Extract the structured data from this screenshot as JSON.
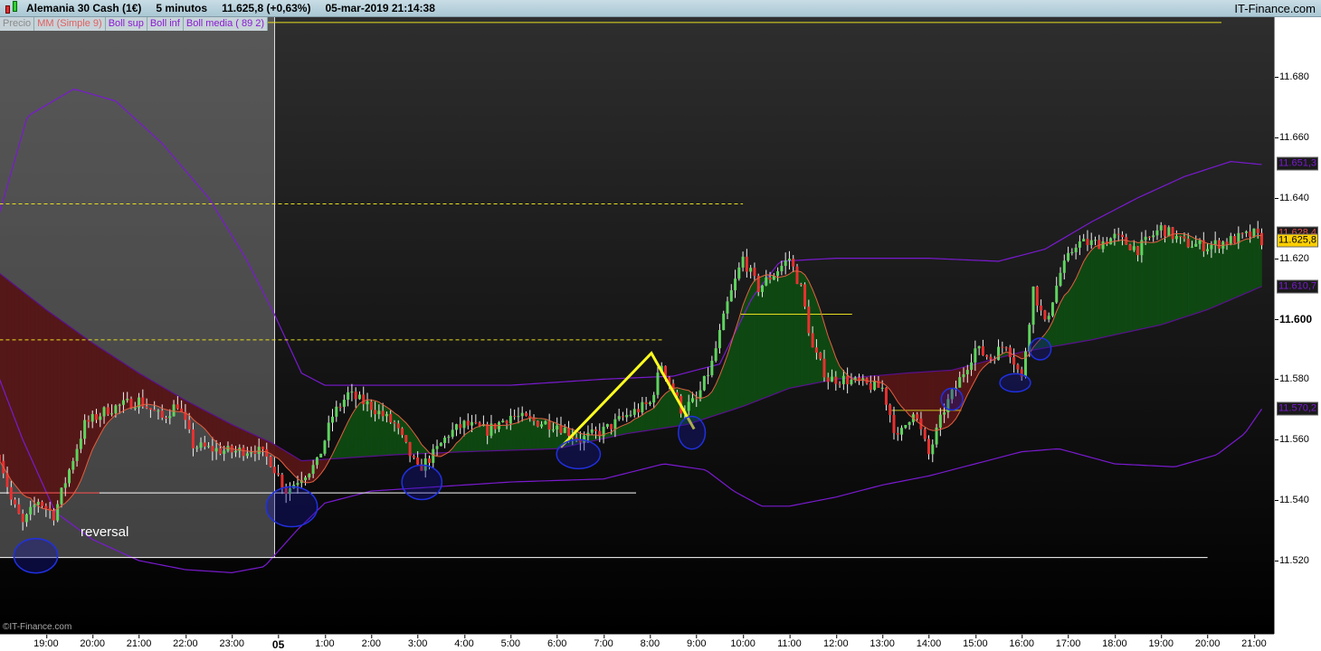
{
  "header": {
    "instrument": "Alemania 30 Cash (1€)",
    "timeframe": "5 minutos",
    "price": "11.625,8 (+0,63%)",
    "datetime": "05-mar-2019 21:14:38",
    "brand": "IT-Finance.com"
  },
  "legend": [
    {
      "label": "Precio",
      "color": "#8a8a8a"
    },
    {
      "label": "MM (Simple 9)",
      "color": "#e06060"
    },
    {
      "label": "Boll sup",
      "color": "#8a1ad0"
    },
    {
      "label": "Boll inf",
      "color": "#8a1ad0"
    },
    {
      "label": "Boll media ( 89 2)",
      "color": "#8a1ad0"
    }
  ],
  "copyright": "©IT-Finance.com",
  "annotation_text": "reversal",
  "chart_data": {
    "type": "candlestick",
    "timeframe_minutes": 5,
    "ylim": [
      11.5005,
      11.704
    ],
    "y_ticks": [
      {
        "v": 11.68,
        "label": "11.680"
      },
      {
        "v": 11.66,
        "label": "11.660"
      },
      {
        "v": 11.64,
        "label": "11.640"
      },
      {
        "v": 11.62,
        "label": "11.620"
      },
      {
        "v": 11.6,
        "label": "11.600",
        "bold": true
      },
      {
        "v": 11.58,
        "label": "11.580"
      },
      {
        "v": 11.56,
        "label": "11.560"
      },
      {
        "v": 11.54,
        "label": "11.540"
      },
      {
        "v": 11.52,
        "label": "11.520"
      }
    ],
    "price_badges": [
      {
        "v": 11.6513,
        "label": "11.651,3",
        "color": "#7a1ad0",
        "bg": "#1a1a1a"
      },
      {
        "v": 11.6284,
        "label": "11.628,4",
        "color": "#e05050",
        "bg": "#1a1a1a"
      },
      {
        "v": 11.6258,
        "label": "11.625,8",
        "color": "#000",
        "bg": "#ffd000"
      },
      {
        "v": 11.6107,
        "label": "11.610,7",
        "color": "#7a1ad0",
        "bg": "#1a1a1a"
      },
      {
        "v": 11.5702,
        "label": "11.570,2",
        "color": "#7a1ad0",
        "bg": "#1a1a1a"
      }
    ],
    "x_ticks": [
      {
        "h": 1,
        "label": "19:00"
      },
      {
        "h": 2,
        "label": "20:00"
      },
      {
        "h": 3,
        "label": "21:00"
      },
      {
        "h": 4,
        "label": "22:00"
      },
      {
        "h": 5,
        "label": "23:00"
      },
      {
        "h": 6,
        "label": "05",
        "bold": true
      },
      {
        "h": 7,
        "label": "1:00"
      },
      {
        "h": 8,
        "label": "2:00"
      },
      {
        "h": 9,
        "label": "3:00"
      },
      {
        "h": 10,
        "label": "4:00"
      },
      {
        "h": 11,
        "label": "5:00"
      },
      {
        "h": 12,
        "label": "6:00"
      },
      {
        "h": 13,
        "label": "7:00"
      },
      {
        "h": 14,
        "label": "8:00"
      },
      {
        "h": 15,
        "label": "9:00"
      },
      {
        "h": 16,
        "label": "10:00"
      },
      {
        "h": 17,
        "label": "11:00"
      },
      {
        "h": 18,
        "label": "12:00"
      },
      {
        "h": 19,
        "label": "13:00"
      },
      {
        "h": 20,
        "label": "14:00"
      },
      {
        "h": 21,
        "label": "15:00"
      },
      {
        "h": 22,
        "label": "16:00"
      },
      {
        "h": 23,
        "label": "17:00"
      },
      {
        "h": 24,
        "label": "18:00"
      },
      {
        "h": 25,
        "label": "19:00"
      },
      {
        "h": 26,
        "label": "20:00"
      },
      {
        "h": 27,
        "label": "21:00"
      }
    ],
    "close_keypoints": [
      [
        0,
        11.555
      ],
      [
        0.25,
        11.54
      ],
      [
        0.5,
        11.532
      ],
      [
        0.83,
        11.54
      ],
      [
        1.17,
        11.535
      ],
      [
        1.5,
        11.55
      ],
      [
        1.83,
        11.565
      ],
      [
        2.33,
        11.57
      ],
      [
        3,
        11.573
      ],
      [
        3.5,
        11.567
      ],
      [
        3.83,
        11.572
      ],
      [
        4.17,
        11.558
      ],
      [
        4.5,
        11.557
      ],
      [
        5,
        11.556
      ],
      [
        5.5,
        11.557
      ],
      [
        5.83,
        11.553
      ],
      [
        6.17,
        11.543
      ],
      [
        6.5,
        11.548
      ],
      [
        6.83,
        11.552
      ],
      [
        7.17,
        11.568
      ],
      [
        7.5,
        11.575
      ],
      [
        8,
        11.571
      ],
      [
        8.5,
        11.565
      ],
      [
        9,
        11.55
      ],
      [
        9.33,
        11.555
      ],
      [
        9.67,
        11.562
      ],
      [
        10,
        11.565
      ],
      [
        10.5,
        11.563
      ],
      [
        11,
        11.568
      ],
      [
        11.5,
        11.566
      ],
      [
        12,
        11.565
      ],
      [
        12.5,
        11.56
      ],
      [
        13,
        11.563
      ],
      [
        13.5,
        11.568
      ],
      [
        14,
        11.572
      ],
      [
        14.25,
        11.585
      ],
      [
        14.67,
        11.57
      ],
      [
        15,
        11.573
      ],
      [
        15.33,
        11.585
      ],
      [
        15.67,
        11.605
      ],
      [
        16,
        11.62
      ],
      [
        16.33,
        11.61
      ],
      [
        16.67,
        11.615
      ],
      [
        17,
        11.62
      ],
      [
        17.25,
        11.61
      ],
      [
        17.5,
        11.59
      ],
      [
        17.83,
        11.58
      ],
      [
        18.17,
        11.58
      ],
      [
        18.67,
        11.578
      ],
      [
        19,
        11.577
      ],
      [
        19.33,
        11.56
      ],
      [
        19.67,
        11.57
      ],
      [
        20,
        11.555
      ],
      [
        20.33,
        11.57
      ],
      [
        20.67,
        11.58
      ],
      [
        21,
        11.59
      ],
      [
        21.33,
        11.587
      ],
      [
        21.67,
        11.592
      ],
      [
        22,
        11.58
      ],
      [
        22.25,
        11.61
      ],
      [
        22.5,
        11.598
      ],
      [
        22.83,
        11.615
      ],
      [
        23.17,
        11.625
      ],
      [
        23.67,
        11.625
      ],
      [
        24,
        11.627
      ],
      [
        24.5,
        11.623
      ],
      [
        25,
        11.63
      ],
      [
        25.5,
        11.625
      ],
      [
        26,
        11.624
      ],
      [
        26.5,
        11.626
      ],
      [
        27,
        11.628
      ],
      [
        27.17,
        11.6258
      ]
    ],
    "series": [
      {
        "name": "Boll sup",
        "color": "#7a1ad0",
        "points": [
          [
            0,
            11.635
          ],
          [
            0.6,
            11.667
          ],
          [
            1.6,
            11.676
          ],
          [
            2.5,
            11.672
          ],
          [
            3.5,
            11.658
          ],
          [
            4.5,
            11.64
          ],
          [
            5.3,
            11.62
          ],
          [
            5.9,
            11.602
          ],
          [
            6.5,
            11.582
          ],
          [
            7,
            11.578
          ],
          [
            9,
            11.578
          ],
          [
            11,
            11.578
          ],
          [
            13,
            11.58
          ],
          [
            14.5,
            11.581
          ],
          [
            15.5,
            11.585
          ],
          [
            16.2,
            11.607
          ],
          [
            16.8,
            11.619
          ],
          [
            18,
            11.62
          ],
          [
            20,
            11.62
          ],
          [
            21.5,
            11.619
          ],
          [
            22.5,
            11.623
          ],
          [
            23.5,
            11.632
          ],
          [
            24.5,
            11.64
          ],
          [
            25.5,
            11.647
          ],
          [
            26.5,
            11.652
          ],
          [
            27.17,
            11.651
          ]
        ]
      },
      {
        "name": "Boll inf",
        "color": "#7a1ad0",
        "points": [
          [
            0,
            11.58
          ],
          [
            0.5,
            11.56
          ],
          [
            1.2,
            11.536
          ],
          [
            2,
            11.527
          ],
          [
            3,
            11.52
          ],
          [
            4,
            11.517
          ],
          [
            5,
            11.516
          ],
          [
            5.7,
            11.518
          ],
          [
            6.4,
            11.53
          ],
          [
            7,
            11.539
          ],
          [
            8,
            11.543
          ],
          [
            9,
            11.544
          ],
          [
            11,
            11.546
          ],
          [
            13,
            11.547
          ],
          [
            14.3,
            11.552
          ],
          [
            15.2,
            11.55
          ],
          [
            15.8,
            11.543
          ],
          [
            16.4,
            11.538
          ],
          [
            17,
            11.538
          ],
          [
            18,
            11.541
          ],
          [
            19,
            11.545
          ],
          [
            20,
            11.548
          ],
          [
            21,
            11.552
          ],
          [
            22,
            11.556
          ],
          [
            22.8,
            11.557
          ],
          [
            24,
            11.552
          ],
          [
            25.3,
            11.551
          ],
          [
            26.2,
            11.555
          ],
          [
            26.8,
            11.562
          ],
          [
            27.17,
            11.5702
          ]
        ]
      },
      {
        "name": "Boll media",
        "color": "#5a1090",
        "points": [
          [
            0,
            11.615
          ],
          [
            1,
            11.603
          ],
          [
            2,
            11.592
          ],
          [
            3,
            11.582
          ],
          [
            4,
            11.573
          ],
          [
            5,
            11.565
          ],
          [
            5.85,
            11.559
          ],
          [
            6.5,
            11.553
          ],
          [
            7.5,
            11.554
          ],
          [
            8.5,
            11.555
          ],
          [
            10,
            11.556
          ],
          [
            12,
            11.557
          ],
          [
            13.5,
            11.562
          ],
          [
            14.8,
            11.565
          ],
          [
            16,
            11.571
          ],
          [
            17,
            11.577
          ],
          [
            18,
            11.58
          ],
          [
            19.5,
            11.582
          ],
          [
            20.5,
            11.583
          ],
          [
            22,
            11.589
          ],
          [
            23.5,
            11.593
          ],
          [
            25,
            11.598
          ],
          [
            26,
            11.603
          ],
          [
            27.17,
            11.6107
          ]
        ]
      }
    ],
    "moving_average": {
      "name": "MM (Simple 9)",
      "period": 9,
      "color": "#e06040"
    },
    "hlines": [
      {
        "v": 11.638,
        "h0": 0,
        "h1": 16,
        "color": "#e8e020",
        "dash": true
      },
      {
        "v": 11.593,
        "h0": 0,
        "h1": 14.3,
        "color": "#e8e020",
        "dash": true
      },
      {
        "v": 11.5424,
        "h0": 0,
        "h1": 13.7,
        "color": "#ffffff"
      },
      {
        "v": 11.521,
        "h0": 0,
        "h1": 26,
        "color": "#ffffff"
      },
      {
        "v": 11.698,
        "h0": 5.35,
        "h1": 26.3,
        "color": "#e8e020"
      },
      {
        "v": 11.5424,
        "h0": 0.2,
        "h1": 2.15,
        "color": "#e03030"
      },
      {
        "v": 11.6015,
        "h0": 15.95,
        "h1": 18.35,
        "color": "#e8e020"
      },
      {
        "v": 11.5697,
        "h0": 19.2,
        "h1": 20.7,
        "color": "#c8c020"
      }
    ],
    "zigzag": [
      [
        12.08,
        11.5575
      ],
      [
        14.03,
        11.5886
      ],
      [
        14.95,
        11.5635
      ]
    ],
    "ellipses": [
      [
        0.78,
        11.5216,
        0.47,
        0.0057
      ],
      [
        6.29,
        11.5378,
        0.55,
        0.0066
      ],
      [
        9.09,
        11.5459,
        0.43,
        0.0057
      ],
      [
        12.46,
        11.5552,
        0.47,
        0.0048
      ],
      [
        14.9,
        11.5623,
        0.29,
        0.0054
      ],
      [
        20.5,
        11.5734,
        0.23,
        0.0036
      ],
      [
        21.86,
        11.5788,
        0.33,
        0.003
      ],
      [
        22.4,
        11.59,
        0.23,
        0.0036
      ]
    ],
    "selection": {
      "h0": 0,
      "h1": 5.92,
      "v_bottom": 11.521
    }
  }
}
